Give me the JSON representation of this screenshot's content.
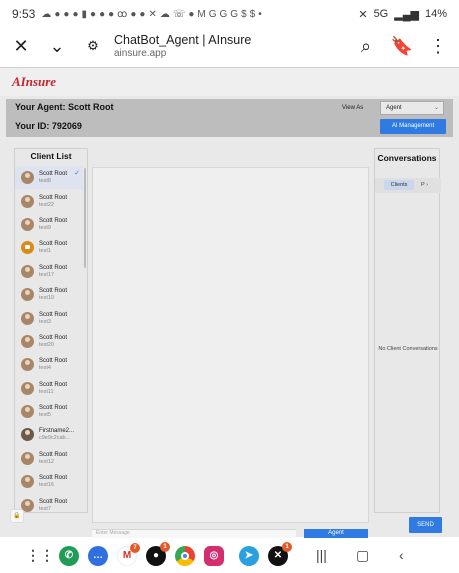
{
  "status_bar": {
    "time": "9:53",
    "left_icons": [
      "cloud-icon",
      "messenger-icon",
      "facebook-icon",
      "facebook-icon",
      "battery-saver-icon",
      "facebook-icon",
      "facebook-icon",
      "facebook-icon",
      "voicemail-icon",
      "facebook-icon",
      "facebook-icon",
      "x-icon",
      "cloud-icon",
      "wifi-call-icon",
      "facebook-icon",
      "gmail-icon",
      "google-icon",
      "google-icon",
      "google-icon",
      "dollar-icon",
      "dollar-icon",
      "dot-icon"
    ],
    "network": "5G",
    "battery": "14%"
  },
  "browser": {
    "title": "ChatBot_Agent | AInsure",
    "url": "ainsure.app"
  },
  "site": {
    "logo": "AInsure",
    "agent_label": "Your Agent: Scott Root",
    "id_label": "Your ID: 792069",
    "view_as_label": "View As",
    "role_value": "Agent",
    "ai_management_label": "AI Management",
    "client_list_title": "Client List",
    "clients": [
      {
        "name": "Scott Root",
        "sub": "test8",
        "active": true
      },
      {
        "name": "Scott Root",
        "sub": "test22"
      },
      {
        "name": "Scott Root",
        "sub": "test9"
      },
      {
        "name": "Scott Root",
        "sub": "test1",
        "avatar": "orange"
      },
      {
        "name": "Scott Root",
        "sub": "test17"
      },
      {
        "name": "Scott Root",
        "sub": "test10"
      },
      {
        "name": "Scott Root",
        "sub": "test3"
      },
      {
        "name": "Scott Root",
        "sub": "test20"
      },
      {
        "name": "Scott Root",
        "sub": "test4"
      },
      {
        "name": "Scott Root",
        "sub": "test11"
      },
      {
        "name": "Scott Root",
        "sub": "test5"
      },
      {
        "name": "Firstname2...",
        "sub": "c9e9c2cab...",
        "avatar": "dark"
      },
      {
        "name": "Scott Root",
        "sub": "test12"
      },
      {
        "name": "Scott Root",
        "sub": "test16"
      },
      {
        "name": "Scott Root",
        "sub": "test7"
      }
    ],
    "conversations_title": "Conversations",
    "tab_clients": "Clients",
    "tab_more": "P",
    "no_conversations": "No Client Conversations",
    "send_label": "SEND",
    "agent_button": "Agent",
    "input_placeholder": "Enter Message"
  },
  "nav": {
    "apps": [
      {
        "name": "apps-grid-icon"
      },
      {
        "name": "phone-app-icon",
        "color": "#1f9c57",
        "badge": ""
      },
      {
        "name": "messages-app-icon",
        "color": "#2f6fe0",
        "badge": ""
      },
      {
        "name": "gmail-app-icon",
        "color": "#ffffff",
        "badge": "7"
      },
      {
        "name": "onlyfans-app-icon",
        "color": "#111111",
        "badge": "1"
      },
      {
        "name": "chrome-app-icon",
        "color": "#ffffff",
        "badge": ""
      },
      {
        "name": "instagram-app-icon",
        "color": "#d42e6e",
        "badge": ""
      },
      {
        "name": "telegram-app-icon",
        "color": "#2aa0e0",
        "badge": ""
      },
      {
        "name": "x-app-icon",
        "color": "#111111",
        "badge": "1"
      }
    ]
  }
}
